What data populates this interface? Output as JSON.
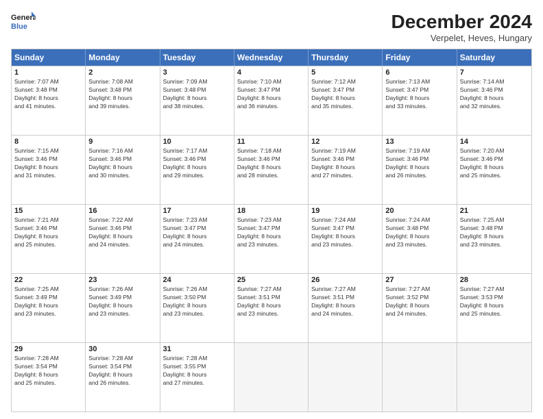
{
  "logo": {
    "line1": "General",
    "line2": "Blue"
  },
  "title": "December 2024",
  "location": "Verpelet, Heves, Hungary",
  "header_days": [
    "Sunday",
    "Monday",
    "Tuesday",
    "Wednesday",
    "Thursday",
    "Friday",
    "Saturday"
  ],
  "weeks": [
    [
      {
        "day": "1",
        "lines": [
          "Sunrise: 7:07 AM",
          "Sunset: 3:48 PM",
          "Daylight: 8 hours",
          "and 41 minutes."
        ]
      },
      {
        "day": "2",
        "lines": [
          "Sunrise: 7:08 AM",
          "Sunset: 3:48 PM",
          "Daylight: 8 hours",
          "and 39 minutes."
        ]
      },
      {
        "day": "3",
        "lines": [
          "Sunrise: 7:09 AM",
          "Sunset: 3:48 PM",
          "Daylight: 8 hours",
          "and 38 minutes."
        ]
      },
      {
        "day": "4",
        "lines": [
          "Sunrise: 7:10 AM",
          "Sunset: 3:47 PM",
          "Daylight: 8 hours",
          "and 36 minutes."
        ]
      },
      {
        "day": "5",
        "lines": [
          "Sunrise: 7:12 AM",
          "Sunset: 3:47 PM",
          "Daylight: 8 hours",
          "and 35 minutes."
        ]
      },
      {
        "day": "6",
        "lines": [
          "Sunrise: 7:13 AM",
          "Sunset: 3:47 PM",
          "Daylight: 8 hours",
          "and 33 minutes."
        ]
      },
      {
        "day": "7",
        "lines": [
          "Sunrise: 7:14 AM",
          "Sunset: 3:46 PM",
          "Daylight: 8 hours",
          "and 32 minutes."
        ]
      }
    ],
    [
      {
        "day": "8",
        "lines": [
          "Sunrise: 7:15 AM",
          "Sunset: 3:46 PM",
          "Daylight: 8 hours",
          "and 31 minutes."
        ]
      },
      {
        "day": "9",
        "lines": [
          "Sunrise: 7:16 AM",
          "Sunset: 3:46 PM",
          "Daylight: 8 hours",
          "and 30 minutes."
        ]
      },
      {
        "day": "10",
        "lines": [
          "Sunrise: 7:17 AM",
          "Sunset: 3:46 PM",
          "Daylight: 8 hours",
          "and 29 minutes."
        ]
      },
      {
        "day": "11",
        "lines": [
          "Sunrise: 7:18 AM",
          "Sunset: 3:46 PM",
          "Daylight: 8 hours",
          "and 28 minutes."
        ]
      },
      {
        "day": "12",
        "lines": [
          "Sunrise: 7:19 AM",
          "Sunset: 3:46 PM",
          "Daylight: 8 hours",
          "and 27 minutes."
        ]
      },
      {
        "day": "13",
        "lines": [
          "Sunrise: 7:19 AM",
          "Sunset: 3:46 PM",
          "Daylight: 8 hours",
          "and 26 minutes."
        ]
      },
      {
        "day": "14",
        "lines": [
          "Sunrise: 7:20 AM",
          "Sunset: 3:46 PM",
          "Daylight: 8 hours",
          "and 25 minutes."
        ]
      }
    ],
    [
      {
        "day": "15",
        "lines": [
          "Sunrise: 7:21 AM",
          "Sunset: 3:46 PM",
          "Daylight: 8 hours",
          "and 25 minutes."
        ]
      },
      {
        "day": "16",
        "lines": [
          "Sunrise: 7:22 AM",
          "Sunset: 3:46 PM",
          "Daylight: 8 hours",
          "and 24 minutes."
        ]
      },
      {
        "day": "17",
        "lines": [
          "Sunrise: 7:23 AM",
          "Sunset: 3:47 PM",
          "Daylight: 8 hours",
          "and 24 minutes."
        ]
      },
      {
        "day": "18",
        "lines": [
          "Sunrise: 7:23 AM",
          "Sunset: 3:47 PM",
          "Daylight: 8 hours",
          "and 23 minutes."
        ]
      },
      {
        "day": "19",
        "lines": [
          "Sunrise: 7:24 AM",
          "Sunset: 3:47 PM",
          "Daylight: 8 hours",
          "and 23 minutes."
        ]
      },
      {
        "day": "20",
        "lines": [
          "Sunrise: 7:24 AM",
          "Sunset: 3:48 PM",
          "Daylight: 8 hours",
          "and 23 minutes."
        ]
      },
      {
        "day": "21",
        "lines": [
          "Sunrise: 7:25 AM",
          "Sunset: 3:48 PM",
          "Daylight: 8 hours",
          "and 23 minutes."
        ]
      }
    ],
    [
      {
        "day": "22",
        "lines": [
          "Sunrise: 7:25 AM",
          "Sunset: 3:49 PM",
          "Daylight: 8 hours",
          "and 23 minutes."
        ]
      },
      {
        "day": "23",
        "lines": [
          "Sunrise: 7:26 AM",
          "Sunset: 3:49 PM",
          "Daylight: 8 hours",
          "and 23 minutes."
        ]
      },
      {
        "day": "24",
        "lines": [
          "Sunrise: 7:26 AM",
          "Sunset: 3:50 PM",
          "Daylight: 8 hours",
          "and 23 minutes."
        ]
      },
      {
        "day": "25",
        "lines": [
          "Sunrise: 7:27 AM",
          "Sunset: 3:51 PM",
          "Daylight: 8 hours",
          "and 23 minutes."
        ]
      },
      {
        "day": "26",
        "lines": [
          "Sunrise: 7:27 AM",
          "Sunset: 3:51 PM",
          "Daylight: 8 hours",
          "and 24 minutes."
        ]
      },
      {
        "day": "27",
        "lines": [
          "Sunrise: 7:27 AM",
          "Sunset: 3:52 PM",
          "Daylight: 8 hours",
          "and 24 minutes."
        ]
      },
      {
        "day": "28",
        "lines": [
          "Sunrise: 7:27 AM",
          "Sunset: 3:53 PM",
          "Daylight: 8 hours",
          "and 25 minutes."
        ]
      }
    ],
    [
      {
        "day": "29",
        "lines": [
          "Sunrise: 7:28 AM",
          "Sunset: 3:54 PM",
          "Daylight: 8 hours",
          "and 25 minutes."
        ]
      },
      {
        "day": "30",
        "lines": [
          "Sunrise: 7:28 AM",
          "Sunset: 3:54 PM",
          "Daylight: 8 hours",
          "and 26 minutes."
        ]
      },
      {
        "day": "31",
        "lines": [
          "Sunrise: 7:28 AM",
          "Sunset: 3:55 PM",
          "Daylight: 8 hours",
          "and 27 minutes."
        ]
      },
      {
        "day": "",
        "lines": []
      },
      {
        "day": "",
        "lines": []
      },
      {
        "day": "",
        "lines": []
      },
      {
        "day": "",
        "lines": []
      }
    ]
  ]
}
